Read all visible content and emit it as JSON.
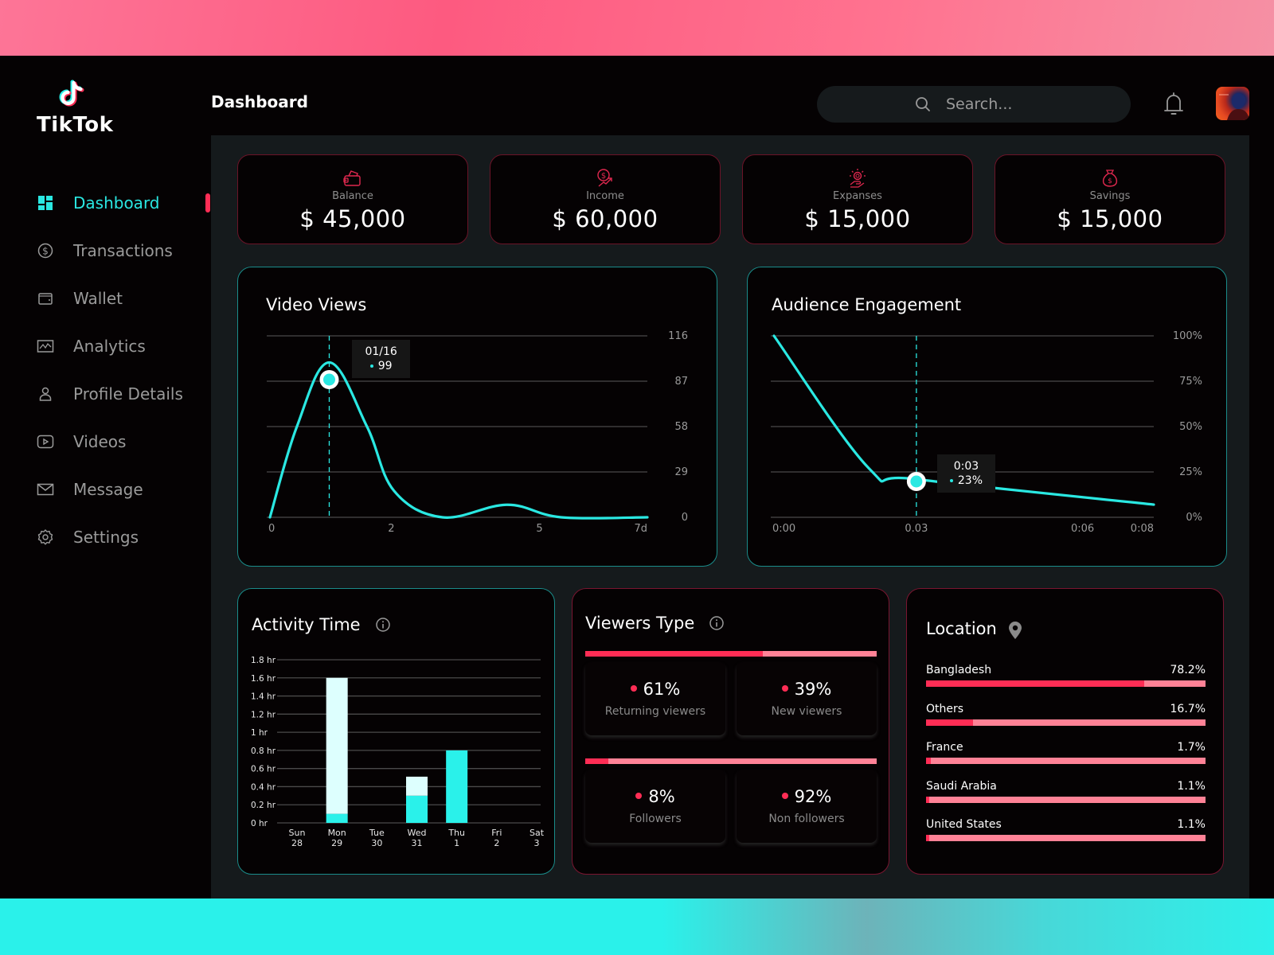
{
  "brand": {
    "name": "TikTok",
    "logo_icon": "tiktok-note-icon"
  },
  "colors": {
    "accent_teal": "#2ae8e2",
    "accent_red": "#ff2d55",
    "accent_pink": "#ff8296",
    "panel_bg": "#151a1c"
  },
  "sidebar": {
    "items": [
      {
        "label": "Dashboard",
        "icon": "grid-icon",
        "active": true
      },
      {
        "label": "Transactions",
        "icon": "dollar-circle-icon",
        "active": false
      },
      {
        "label": "Wallet",
        "icon": "wallet-icon",
        "active": false
      },
      {
        "label": "Analytics",
        "icon": "chart-icon",
        "active": false
      },
      {
        "label": "Profile Details",
        "icon": "user-icon",
        "active": false
      },
      {
        "label": "Videos",
        "icon": "play-icon",
        "active": false
      },
      {
        "label": "Message",
        "icon": "mail-icon",
        "active": false
      },
      {
        "label": "Settings",
        "icon": "gear-icon",
        "active": false
      }
    ]
  },
  "header": {
    "title": "Dashboard",
    "search_placeholder": "Search...",
    "notification_icon": "bell-icon",
    "avatar_alt": "User avatar"
  },
  "stats": [
    {
      "label": "Balance",
      "value": "$ 45,000",
      "icon": "wallet-icon"
    },
    {
      "label": "Income",
      "value": "$ 60,000",
      "icon": "income-icon"
    },
    {
      "label": "Expanses",
      "value": "$ 15,000",
      "icon": "expense-icon"
    },
    {
      "label": "Savings",
      "value": "$ 15,000",
      "icon": "money-bag-icon"
    }
  ],
  "chart_data": [
    {
      "type": "line",
      "title": "Video Views",
      "x_ticks": [
        "0",
        "2",
        "5",
        "7d"
      ],
      "x_tick_values": [
        0,
        2.25,
        5,
        7
      ],
      "y_ticks": [
        "116",
        "87",
        "58",
        "29",
        "0"
      ],
      "ylim": [
        0,
        116
      ],
      "xlim": [
        0,
        7
      ],
      "series": [
        {
          "name": "Views",
          "x": [
            0,
            0.5,
            1.1,
            1.8,
            2.3,
            3.2,
            4.4,
            5.4,
            7
          ],
          "values": [
            0,
            58,
            99,
            58,
            17,
            0,
            8,
            0,
            0
          ]
        }
      ],
      "tooltip": {
        "x": 1.1,
        "label": "01/16",
        "value": "99"
      },
      "grid": true,
      "legend": "none"
    },
    {
      "type": "line",
      "title": "Audience Engagement",
      "x_ticks": [
        "0:00",
        "0.03",
        "0:06",
        "0:08"
      ],
      "x_tick_values": [
        0,
        3,
        6.5,
        8
      ],
      "y_ticks": [
        "100%",
        "75%",
        "50%",
        "25%",
        "0%"
      ],
      "ylim": [
        0,
        100
      ],
      "xlim": [
        0,
        8
      ],
      "series": [
        {
          "name": "Retention",
          "x": [
            0,
            2.0,
            3.0,
            8.0
          ],
          "values": [
            100,
            27,
            21,
            7
          ]
        }
      ],
      "tooltip": {
        "x": 3.0,
        "label": "0:03",
        "value": "23%"
      },
      "grid": true,
      "legend": "none"
    },
    {
      "type": "bar",
      "title": "Activity Time",
      "categories": [
        "Sun",
        "Mon",
        "Tue",
        "Wed",
        "Thu",
        "Fri",
        "Sat"
      ],
      "category_dates": [
        "28",
        "29",
        "30",
        "31",
        "1",
        "2",
        "3"
      ],
      "y_ticks": [
        "1.8 hr",
        "1.6 hr",
        "1.4 hr",
        "1.2 hr",
        "1 hr",
        "0.8 hr",
        "0.6 hr",
        "0.4 hr",
        "0.2 hr",
        "0 hr"
      ],
      "ylim": [
        0,
        1.8
      ],
      "series": [
        {
          "name": "Primary",
          "color": "#2af1ea",
          "values": [
            0,
            0.1,
            0,
            0.3,
            0.8,
            0,
            0
          ]
        },
        {
          "name": "Secondary",
          "color": "#ddfffe",
          "values": [
            0,
            1.5,
            0,
            0.21,
            0,
            0,
            0
          ]
        }
      ],
      "grid": true,
      "legend": "none"
    }
  ],
  "activity": {
    "title": "Activity Time",
    "info_icon": "info-icon"
  },
  "viewers_type": {
    "title": "Viewers Type",
    "info_icon": "info-icon",
    "groups": [
      {
        "split": 61,
        "items": [
          {
            "pct": "61%",
            "label": "Returning viewers"
          },
          {
            "pct": "39%",
            "label": "New viewers"
          }
        ]
      },
      {
        "split": 8,
        "items": [
          {
            "pct": "8%",
            "label": "Followers"
          },
          {
            "pct": "92%",
            "label": "Non followers"
          }
        ]
      }
    ]
  },
  "location": {
    "title": "Location",
    "icon": "map-pin-icon",
    "rows": [
      {
        "country": "Bangladesh",
        "pct_label": "78.2%",
        "pct": 78.2
      },
      {
        "country": "Others",
        "pct_label": "16.7%",
        "pct": 16.7
      },
      {
        "country": "France",
        "pct_label": "1.7%",
        "pct": 1.7
      },
      {
        "country": "Saudi Arabia",
        "pct_label": "1.1%",
        "pct": 1.1
      },
      {
        "country": "United States",
        "pct_label": "1.1%",
        "pct": 1.1
      }
    ]
  }
}
